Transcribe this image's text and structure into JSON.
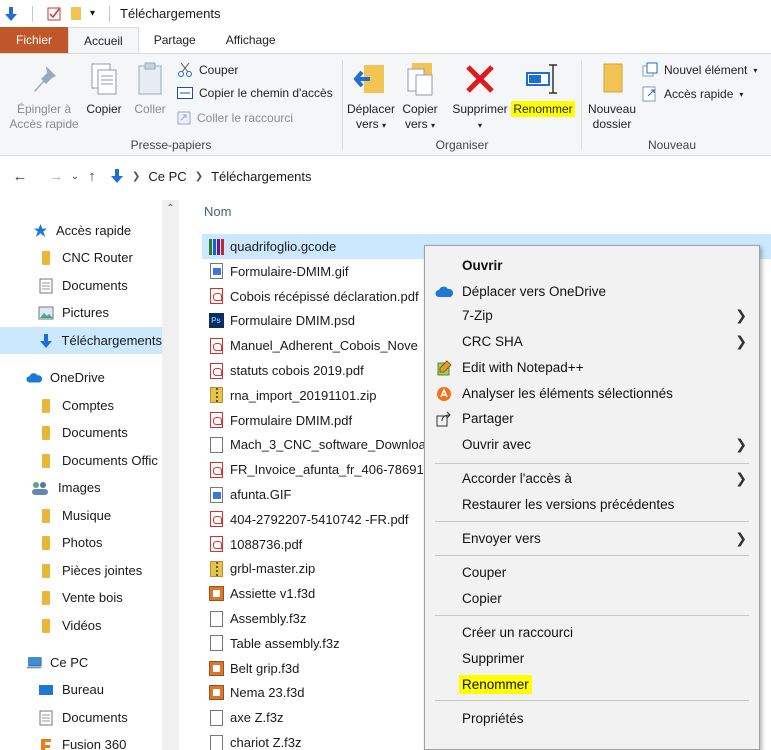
{
  "window": {
    "title": "Téléchargements"
  },
  "tabs": [
    "Fichier",
    "Accueil",
    "Partage",
    "Affichage"
  ],
  "ribbon": {
    "presse_papiers": {
      "label": "Presse-papiers",
      "epingler": "Épingler à\nAccès rapide",
      "epingler_l1": "Épingler à",
      "epingler_l2": "Accès rapide",
      "copier": "Copier",
      "coller": "Coller",
      "couper": "Couper",
      "copier_chemin": "Copier le chemin d'accès",
      "coller_raccourci": "Coller le raccourci"
    },
    "organiser": {
      "label": "Organiser",
      "deplacer_l1": "Déplacer",
      "deplacer_l2": "vers",
      "copier_l1": "Copier",
      "copier_l2": "vers",
      "supprimer": "Supprimer",
      "renommer": "Renommer"
    },
    "nouveau": {
      "label": "Nouveau",
      "nouveau_l1": "Nouveau",
      "nouveau_l2": "dossier",
      "nouvel_element": "Nouvel élément",
      "acces_rapide": "Accès rapide"
    }
  },
  "address": {
    "crumbs": [
      "Ce PC",
      "Téléchargements"
    ]
  },
  "nav": {
    "items": [
      {
        "label": "Accès rapide",
        "icon": "star-icon"
      },
      {
        "label": "CNC Router",
        "icon": "folder-icon"
      },
      {
        "label": "Documents",
        "icon": "documents-icon"
      },
      {
        "label": "Pictures",
        "icon": "pictures-icon"
      },
      {
        "label": "Téléchargements",
        "icon": "download-icon"
      },
      {
        "label": "OneDrive",
        "icon": "cloud-icon"
      },
      {
        "label": "Comptes",
        "icon": "folder-icon"
      },
      {
        "label": "Documents",
        "icon": "folder-icon"
      },
      {
        "label": "Documents Offic",
        "icon": "folder-icon"
      },
      {
        "label": "Images",
        "icon": "images-icon"
      },
      {
        "label": "Musique",
        "icon": "folder-icon"
      },
      {
        "label": "Photos",
        "icon": "folder-icon"
      },
      {
        "label": "Pièces jointes",
        "icon": "folder-icon"
      },
      {
        "label": "Vente bois",
        "icon": "folder-icon"
      },
      {
        "label": "Vidéos",
        "icon": "folder-icon"
      },
      {
        "label": "Ce PC",
        "icon": "pc-icon"
      },
      {
        "label": "Bureau",
        "icon": "desktop-icon"
      },
      {
        "label": "Documents",
        "icon": "documents-icon"
      },
      {
        "label": "Fusion 360",
        "icon": "fusion-icon"
      }
    ]
  },
  "files": {
    "column": "Nom",
    "rows": [
      {
        "name": "quadrifoglio.gcode",
        "type": "gcode"
      },
      {
        "name": "Formulaire-DMIM.gif",
        "type": "gif"
      },
      {
        "name": "Cobois récépissé déclaration.pdf",
        "type": "pdf"
      },
      {
        "name": "Formulaire DMIM.psd",
        "type": "psd"
      },
      {
        "name": "Manuel_Adherent_Cobois_Nove",
        "type": "pdf"
      },
      {
        "name": "statuts cobois 2019.pdf",
        "type": "pdf"
      },
      {
        "name": "rna_import_20191101.zip",
        "type": "zip"
      },
      {
        "name": "Formulaire DMIM.pdf",
        "type": "pdf"
      },
      {
        "name": "Mach_3_CNC_software_Downloa",
        "type": "doc"
      },
      {
        "name": "FR_Invoice_afunta_fr_406-78691",
        "type": "pdf"
      },
      {
        "name": "afunta.GIF",
        "type": "gif"
      },
      {
        "name": "404-2792207-5410742 -FR.pdf",
        "type": "pdf"
      },
      {
        "name": "1088736.pdf",
        "type": "pdf"
      },
      {
        "name": "grbl-master.zip",
        "type": "zip"
      },
      {
        "name": "Assiette v1.f3d",
        "type": "f3d"
      },
      {
        "name": "Assembly.f3z",
        "type": "doc"
      },
      {
        "name": "Table assembly.f3z",
        "type": "doc"
      },
      {
        "name": "Belt grip.f3d",
        "type": "f3d"
      },
      {
        "name": "Nema 23.f3d",
        "type": "f3d"
      },
      {
        "name": "axe Z.f3z",
        "type": "doc"
      },
      {
        "name": "chariot Z.f3z",
        "type": "doc"
      }
    ]
  },
  "context_menu": {
    "ouvrir": "Ouvrir",
    "onedrive": "Déplacer vers OneDrive",
    "zip7": "7-Zip",
    "crc": "CRC SHA",
    "notepad": "Edit with Notepad++",
    "analyser": "Analyser les éléments sélectionnés",
    "partager": "Partager",
    "ouvrir_avec": "Ouvrir avec",
    "accorder": "Accorder l'accès à",
    "restaurer": "Restaurer les versions précédentes",
    "envoyer": "Envoyer vers",
    "couper": "Couper",
    "copier": "Copier",
    "raccourci": "Créer un raccourci",
    "supprimer": "Supprimer",
    "renommer": "Renommer",
    "proprietes": "Propriétés"
  },
  "colors": {
    "file_tab": "#c0572b",
    "selection": "#cce8ff",
    "highlight": "#ffff00"
  }
}
